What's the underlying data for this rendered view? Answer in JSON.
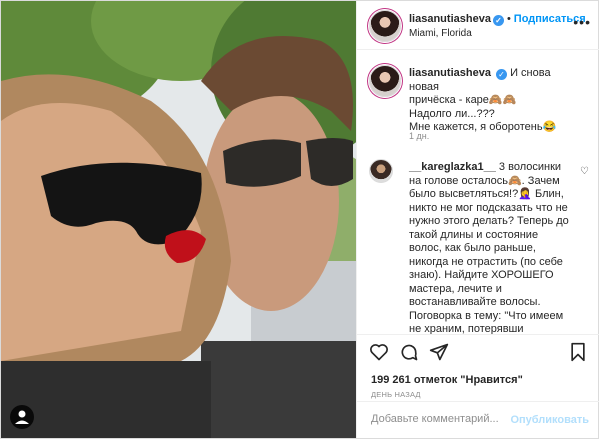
{
  "header": {
    "username": "liasanutiasheva",
    "separator": "•",
    "follow_label": "Подписаться",
    "location": "Miami, Florida",
    "verified_glyph": "✓",
    "more_glyph": "•••"
  },
  "caption": {
    "username": "liasanutiasheva",
    "verified_glyph": "✓",
    "text_line1": "И снова новая",
    "text_line2": "причёска - каре🙈🙈",
    "text_line3": "Надолго ли...???",
    "text_line4": "Мне кажется, я оборотень😂",
    "time": "1 дн."
  },
  "comment": {
    "username": "__kareglazka1__",
    "text": "3 волосинки на голове осталось🙈. Зачем было высветляться!?🤦‍♀️ Блин, никто не мог подсказать что не нужно этого делать? Теперь до такой длины и состояние волос, как было раньше, никогда не отрастить (по себе знаю). Найдите ХОРОШЕГО мастера, лечите и востанавливайте волосы. Поговорка в тему: \"Что имеем не храним, потерявши плачем\".",
    "like_glyph": "♡"
  },
  "actions": {
    "likes": "199 261 отметок \"Нравится\"",
    "date": "ДЕНЬ НАЗАД"
  },
  "add_comment": {
    "placeholder": "Добавьте комментарий...",
    "publish_label": "Опубликовать"
  },
  "icons": {
    "like": "heart-icon",
    "comment": "comment-icon",
    "share": "share-icon",
    "save": "bookmark-icon",
    "more": "more-options-icon",
    "tagged": "user-tag-icon"
  },
  "colors": {
    "accent": "#0095f6",
    "verified": "#3897f0",
    "muted": "#8e8e8e",
    "border": "#dbdbdb"
  }
}
